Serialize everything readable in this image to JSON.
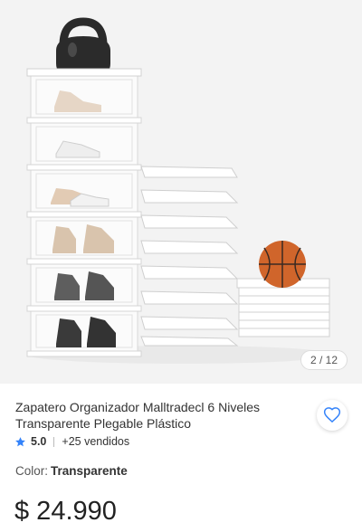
{
  "gallery": {
    "counter": "2 / 12",
    "image_alt": "Zapatero organizador transparente de 6 niveles"
  },
  "product": {
    "title": "Zapatero Organizador Malltradecl 6 Niveles Transparente Plegable Plástico",
    "rating": "5.0",
    "sold": "+25 vendidos",
    "color_label": "Color:",
    "color_value": "Transparente",
    "price": "$ 24.990"
  },
  "colors": {
    "star": "#3483fa",
    "heart": "#3483fa",
    "basketball": "#d0652b"
  }
}
